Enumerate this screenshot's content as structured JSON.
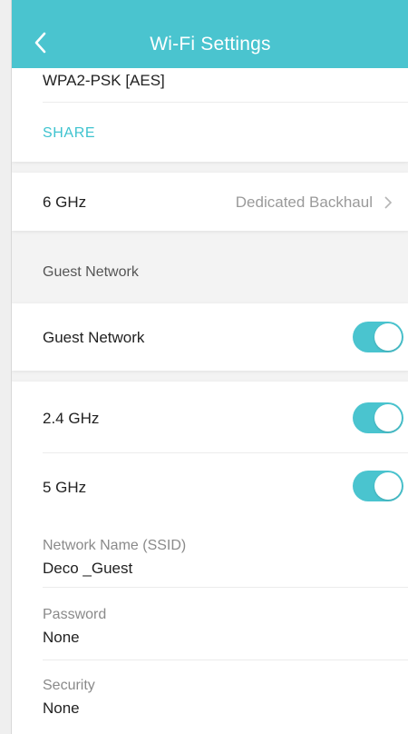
{
  "header": {
    "title": "Wi-Fi Settings"
  },
  "main_network": {
    "security_value": "WPA2-PSK [AES]",
    "share_label": "SHARE"
  },
  "band_6ghz": {
    "label": "6 GHz",
    "value": "Dedicated Backhaul"
  },
  "guest_section": {
    "label": "Guest Network"
  },
  "guest_toggle": {
    "label": "Guest Network",
    "enabled": true
  },
  "guest_bands": [
    {
      "label": "2.4 GHz",
      "enabled": true
    },
    {
      "label": "5 GHz",
      "enabled": true
    }
  ],
  "guest_details": {
    "ssid_label": "Network Name (SSID)",
    "ssid_value": "Deco _Guest",
    "password_label": "Password",
    "password_value": "None",
    "security_label": "Security",
    "security_value": "None"
  },
  "colors": {
    "accent": "#4ac4cf",
    "background": "#f3f3f3"
  },
  "icons": {
    "back": "chevron-left-icon",
    "row_arrow": "chevron-right-icon"
  }
}
